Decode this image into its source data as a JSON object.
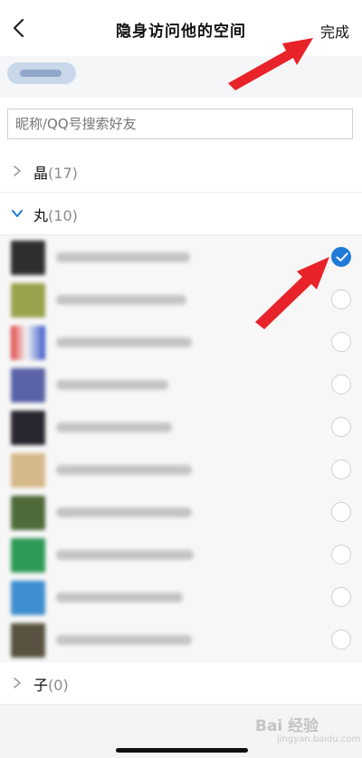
{
  "header": {
    "title": "隐身访问他的空间",
    "done_label": "完成"
  },
  "search": {
    "placeholder": "昵称/QQ号搜索好友"
  },
  "groups": [
    {
      "name": "晶",
      "count": "(17)",
      "expanded": false
    },
    {
      "name": "丸",
      "count": "(10)",
      "expanded": true
    },
    {
      "name": "子",
      "count": "(0)",
      "expanded": false
    }
  ],
  "friends": [
    {
      "checked": true
    },
    {
      "checked": false
    },
    {
      "checked": false
    },
    {
      "checked": false
    },
    {
      "checked": false
    },
    {
      "checked": false
    },
    {
      "checked": false
    },
    {
      "checked": false
    },
    {
      "checked": false
    },
    {
      "checked": false
    }
  ],
  "watermark": {
    "text": "Bai 经验",
    "sub": "jingyan.baidu.com"
  },
  "colors": {
    "accent": "#1e7bd7",
    "arrow": "#e8232a"
  }
}
